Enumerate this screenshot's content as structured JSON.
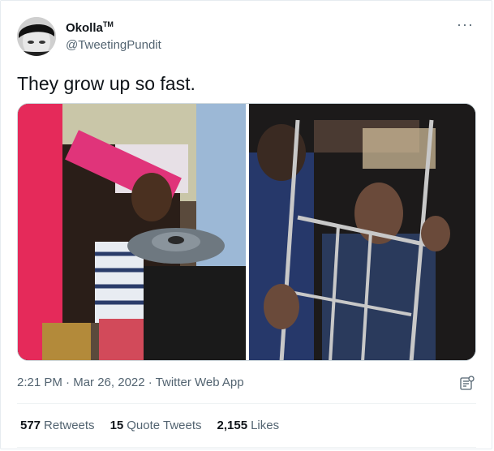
{
  "tweet": {
    "display_name": "Okolla",
    "display_name_suffix": "TM",
    "handle": "@TweetingPundit",
    "more_label": "···",
    "text": "They grow up so fast.",
    "time": "2:21 PM",
    "date": "Mar 26, 2022",
    "source": "Twitter Web App",
    "separator": " · "
  },
  "stats": [
    {
      "count": "577",
      "label": "Retweets"
    },
    {
      "count": "15",
      "label": "Quote Tweets"
    },
    {
      "count": "2,155",
      "label": "Likes"
    }
  ],
  "icons": {
    "more": "more-dots-icon",
    "analytics": "analytics-icon"
  },
  "colors": {
    "text_primary": "#0f1419",
    "text_secondary": "#536471",
    "border": "#e6ecf0"
  }
}
